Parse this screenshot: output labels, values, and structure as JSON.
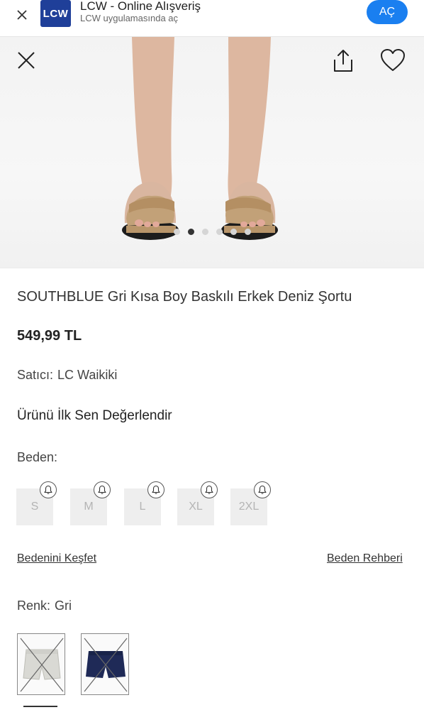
{
  "banner": {
    "title": "LCW - Online Alışveriş",
    "subtitle": "LCW uygulamasında aç",
    "logo_text": "LCW",
    "open_label": "AÇ",
    "accent": "#1a7ff0",
    "logo_color": "#1f3f99"
  },
  "gallery": {
    "slide_count": 6,
    "active_index": 1,
    "icons": [
      "close-icon",
      "share-icon",
      "heart-icon"
    ]
  },
  "product": {
    "title": "SOUTHBLUE Gri Kısa Boy Baskılı Erkek Deniz Şortu",
    "price": "549,99 TL",
    "seller_label": "Satıcı:",
    "seller_name": "LC Waikiki",
    "review_cta": "Ürünü İlk Sen Değerlendir"
  },
  "sizes": {
    "label": "Beden:",
    "options": [
      "S",
      "M",
      "L",
      "XL",
      "2XL"
    ],
    "all_out_of_stock": true
  },
  "links": {
    "discover_size": "Bedenini Keşfet",
    "size_guide": "Beden Rehberi"
  },
  "color": {
    "label": "Renk:",
    "value": "Gri",
    "swatches": [
      {
        "name": "Gri",
        "hex": "#d9d9d4",
        "selected": true,
        "unavailable": true
      },
      {
        "name": "Lacivert",
        "hex": "#1f2a57",
        "selected": false,
        "unavailable": true
      }
    ]
  }
}
